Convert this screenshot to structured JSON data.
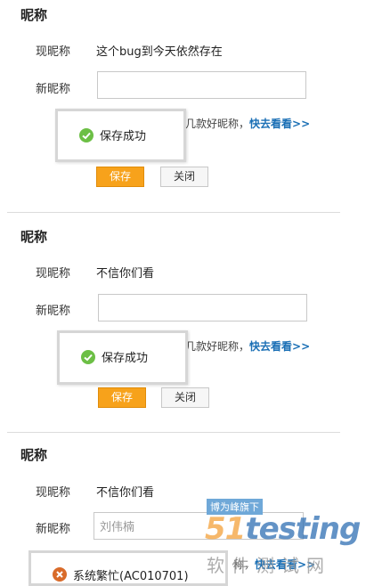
{
  "panels": [
    {
      "title": "昵称",
      "current_label": "现昵称",
      "current_value": "这个bug到今天依然存在",
      "new_label": "新昵称",
      "input_value": "",
      "hint_prefix": "几款好昵称，",
      "hint_link": "快去看看>>",
      "save_label": "保存",
      "close_label": "关闭",
      "toast_message": "保存成功"
    },
    {
      "title": "昵称",
      "current_label": "现昵称",
      "current_value": "不信你们看",
      "new_label": "新昵称",
      "input_value": "",
      "hint_prefix": "几款好昵称，",
      "hint_link": "快去看看>>",
      "save_label": "保存",
      "close_label": "关闭",
      "toast_message": "保存成功"
    },
    {
      "title": "昵称",
      "current_label": "现昵称",
      "current_value": "不信你们看",
      "new_label": "新昵称",
      "input_value": "刘伟楠",
      "hint_prefix": "称，",
      "hint_link": "快去看看>>",
      "error_message": "系统繁忙(AC010701)"
    }
  ],
  "watermark": {
    "tag": "博为峰旗下",
    "brand_a": "51",
    "brand_b": "testing",
    "sub": "软件测试网"
  },
  "colors": {
    "save_button": "#f7a21b",
    "link": "#1a6fb5",
    "success_icon": "#6cbf45",
    "error_icon": "#d96b2a"
  }
}
